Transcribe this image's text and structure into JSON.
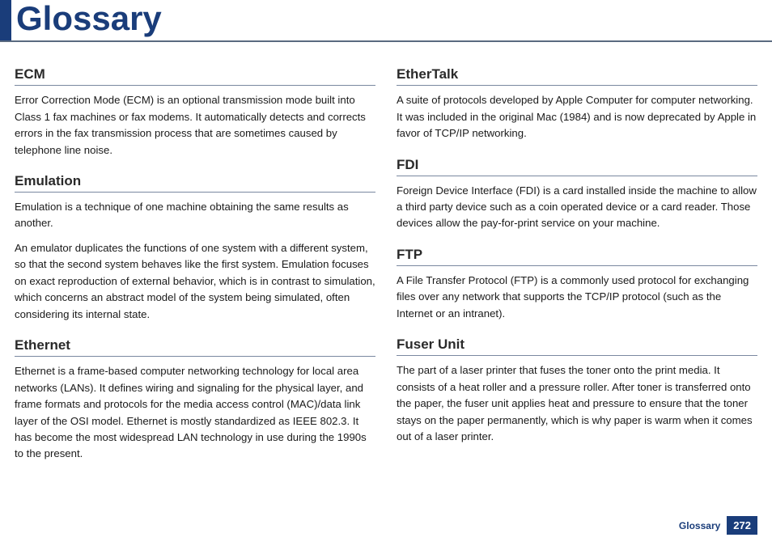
{
  "header": {
    "title": "Glossary"
  },
  "left": {
    "entries": [
      {
        "term": "ECM",
        "paragraphs": [
          "Error Correction Mode (ECM) is an optional transmission mode built into Class 1 fax machines or fax modems. It automatically detects and corrects errors in the fax transmission process that are sometimes caused by telephone line noise."
        ]
      },
      {
        "term": "Emulation",
        "paragraphs": [
          "Emulation is a technique of one machine obtaining the same results as another.",
          "An emulator duplicates the functions of one system with a different system, so that the second system behaves like the first system. Emulation focuses on exact reproduction of external behavior, which is in contrast to simulation, which concerns an abstract model of the system being simulated, often considering its internal state."
        ]
      },
      {
        "term": "Ethernet",
        "paragraphs": [
          "Ethernet is a frame-based computer networking technology for local area networks (LANs). It defines wiring and signaling for the physical layer, and frame formats and protocols for the media access control (MAC)/data link layer of the OSI model. Ethernet is mostly standardized as IEEE 802.3. It has become the most widespread LAN technology in use during the 1990s to the present."
        ]
      }
    ]
  },
  "right": {
    "entries": [
      {
        "term": "EtherTalk",
        "paragraphs": [
          "A suite of protocols developed by Apple Computer for computer networking. It was included in the original Mac (1984) and is now deprecated by Apple in favor of TCP/IP networking."
        ]
      },
      {
        "term": "FDI",
        "paragraphs": [
          "Foreign Device Interface (FDI) is a card installed inside the machine to allow a third party device such as a coin operated device or a card reader. Those devices allow the pay-for-print service on your machine."
        ]
      },
      {
        "term": "FTP",
        "paragraphs": [
          "A File Transfer Protocol (FTP) is a commonly used protocol for exchanging files over any network that supports the TCP/IP protocol (such as the Internet or an intranet)."
        ]
      },
      {
        "term": "Fuser Unit",
        "paragraphs": [
          "The part of a laser printer that fuses the toner onto the print media. It consists of a heat roller and a pressure roller. After toner is transferred onto the paper, the fuser unit applies heat and pressure to ensure that the toner stays on the paper permanently, which is why paper is warm when it comes out of a laser printer."
        ]
      }
    ]
  },
  "footer": {
    "label": "Glossary",
    "page": "272"
  }
}
